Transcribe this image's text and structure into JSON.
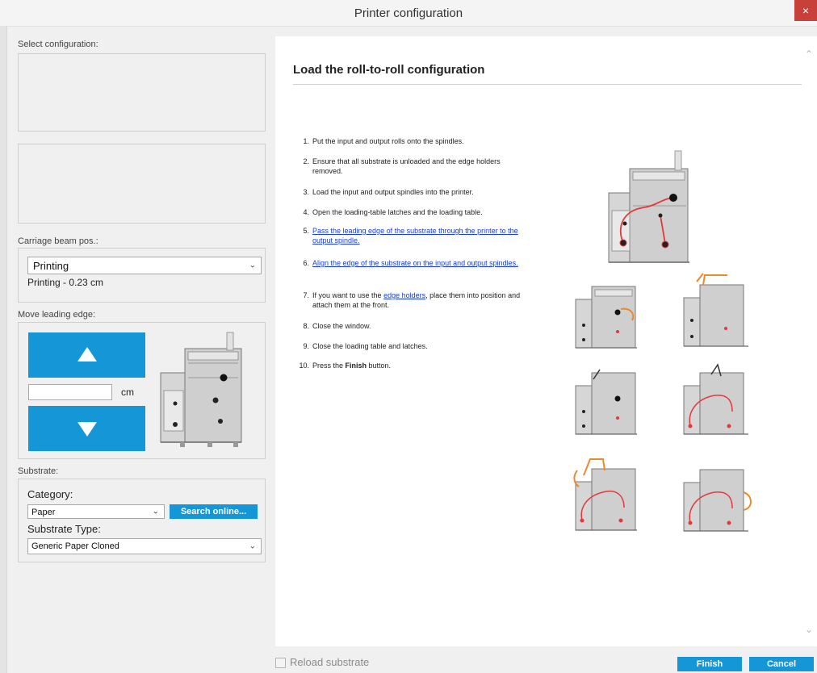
{
  "window": {
    "title": "Printer configuration",
    "close_glyph": "×"
  },
  "left": {
    "select_config_label": "Select configuration:",
    "carriage": {
      "label": "Carriage beam pos.:",
      "selected": "Printing",
      "value_text": "Printing - 0.23 cm"
    },
    "move_edge": {
      "label": "Move leading edge:",
      "unit": "cm",
      "input_value": "",
      "up_icon": "up-triangle",
      "down_icon": "down-triangle"
    },
    "substrate": {
      "label": "Substrate:",
      "category_label": "Category:",
      "category_value": "Paper",
      "search_button": "Search online...",
      "type_label": "Substrate Type:",
      "type_value": "Generic Paper Cloned"
    }
  },
  "main": {
    "title": "Load the roll-to-roll configuration",
    "steps": [
      {
        "num": "1.",
        "text": "Put the input and output rolls onto the spindles."
      },
      {
        "num": "2.",
        "text": "Ensure that all substrate is unloaded and the edge holders removed."
      },
      {
        "num": "3.",
        "text": "Load the input and output spindles into the printer."
      },
      {
        "num": "4.",
        "text": "Open the loading-table latches and the loading table."
      },
      {
        "num": "5.",
        "text": "Pass the leading edge of the substrate through the printer to the output spindle."
      },
      {
        "num": "6.",
        "text": "Align the edge of the substrate on the input and output spindles."
      },
      {
        "num": "7.",
        "pre": "If you want to use the ",
        "link": "edge holders",
        "post": ", place them into position and attach them at the front."
      },
      {
        "num": "8.",
        "text": "Close the window."
      },
      {
        "num": "9.",
        "text": "Close the loading table and latches."
      },
      {
        "num": "10.",
        "pre": "Press the ",
        "bold": "Finish",
        "post": " button."
      }
    ]
  },
  "bottom": {
    "reload_label": "Reload substrate",
    "reload_checked": false,
    "finish": "Finish",
    "cancel": "Cancel"
  },
  "colors": {
    "accent": "#1596d6",
    "link": "#1a3fd0",
    "paper_path": "#e03a3a",
    "arrow": "#e88a2e"
  }
}
